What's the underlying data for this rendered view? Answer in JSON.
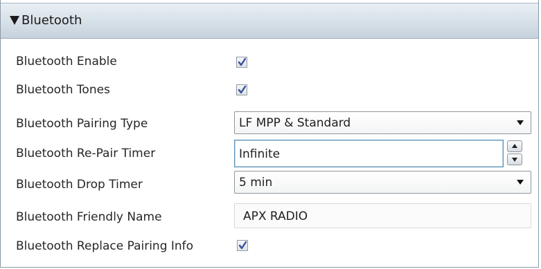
{
  "section": {
    "title": "Bluetooth",
    "expanded": true,
    "expand_icon": "collapse-triangle-icon"
  },
  "settings": [
    {
      "label": "Bluetooth Enable",
      "type": "checkbox",
      "checked": true
    },
    {
      "label": "Bluetooth Tones",
      "type": "checkbox",
      "checked": true
    },
    {
      "label": "Bluetooth Pairing Type",
      "type": "dropdown",
      "value": "LF MPP & Standard"
    },
    {
      "label": "Bluetooth Re-Pair Timer",
      "type": "spinner",
      "value": "Infinite"
    },
    {
      "label": "Bluetooth Drop Timer",
      "type": "dropdown",
      "value": "5 min"
    },
    {
      "label": "Bluetooth Friendly Name",
      "type": "readonly-text",
      "value": "APX RADIO"
    },
    {
      "label": "Bluetooth Replace Pairing Info",
      "type": "checkbox",
      "checked": true
    }
  ],
  "colors": {
    "header_gradient_top": "#e9eff4",
    "header_gradient_bottom": "#c6d2dc",
    "check_mark": "#3a4f99",
    "focus_border": "#5b8fb5"
  }
}
